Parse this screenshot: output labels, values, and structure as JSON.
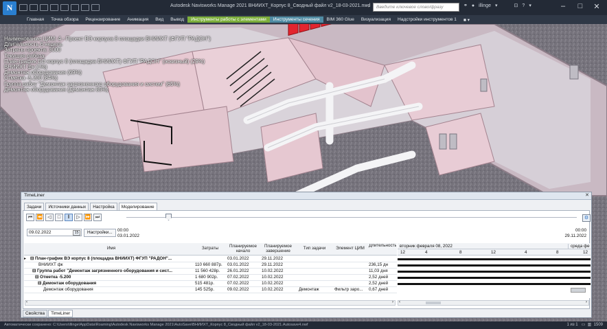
{
  "window": {
    "title": "Autodesk Navisworks Manage 2021   ВНИИХТ_Корпус 8_Сводный файл v2_18-03-2021.nwd",
    "search_placeholder": "Введите ключевое слово/фразу",
    "user": "illinge"
  },
  "ribbon_tabs": [
    "Главная",
    "Точка обзора",
    "Рецензирование",
    "Анимация",
    "Вид",
    "Вывод",
    "Инструменты работы с элементами",
    "Инструменты сечения",
    "BIM 360 Glue",
    "Визуализация",
    "Надстройки инструментов 1"
  ],
  "overlay": [
    "Наименование ЦИМ: 4 - Проект ВЭ корпуса 8 площадки ВНИИХТ (ФГУП \"РАДОН\")",
    "Длительность 6 недель",
    "Затраты проекта: 3000",
    "Текущая работа:",
    "План-график ВЭ корпус 8 (площадка ВНИИХТ) ФГУП \"РАДОН\" (эскизный) (29%)",
    "ВНИИХТ фк (1%)",
    "Демонтаж оборудования (69%)",
    "Отметка -5.200 (84%)",
    "Группа работ \"Демонтаж загрязненного оборудования и систем\" (65%)",
    "Демонтаж оборудования (Демонтаж 85%)"
  ],
  "timeliner": {
    "title": "TimeLiner",
    "tabs": [
      "Задачи",
      "Источники данных",
      "Настройка",
      "Моделирование"
    ],
    "current_date": "09.02.2022",
    "settings_button": "Настройки...",
    "start_time": "00:00",
    "start_date": "03.01.2022",
    "end_time": "00:00",
    "end_date": "29.11.2022",
    "columns": [
      "Имя",
      "Затраты",
      "Планируемое начало",
      "Планируемое завершение",
      "Тип задачи",
      "Элемент ЦИМ",
      "Длительность"
    ],
    "rows": [
      {
        "name": "⊟ План-график ВЭ корпус 8 (площадка ВНИИХТ) ФГУП \"РАДОН\"...",
        "cost": "",
        "start": "03.01.2022",
        "end": "29.11.2022",
        "type": "",
        "element": "",
        "duration": "",
        "bold": true
      },
      {
        "name": "ВНИИХТ фк",
        "cost": "110 660 887р.",
        "start": "03.01.2022",
        "end": "29.11.2022",
        "type": "",
        "element": "",
        "duration": "236,15 дн",
        "bold": false
      },
      {
        "name": "⊟ Группа работ \"Демонтаж загрязненного оборудования и сист...",
        "cost": "11 560 428р.",
        "start": "26.01.2022",
        "end": "10.02.2022",
        "type": "",
        "element": "",
        "duration": "11,03 дня",
        "bold": true
      },
      {
        "name": "⊟ Отметка -5.200",
        "cost": "1 680 902р.",
        "start": "07.02.2022",
        "end": "10.02.2022",
        "type": "",
        "element": "",
        "duration": "2,52 дней",
        "bold": true
      },
      {
        "name": "⊟ Демонтаж оборудования",
        "cost": "515 481р.",
        "start": "07.02.2022",
        "end": "10.02.2022",
        "type": "",
        "element": "",
        "duration": "2,52 дней",
        "bold": true
      },
      {
        "name": "Демонтаж оборудования",
        "cost": "145 525р.",
        "start": "09.02.2022",
        "end": "10.02.2022",
        "type": "Демонтаж",
        "element": "Фильтр заро...",
        "duration": "0,67 дней",
        "bold": false
      }
    ],
    "gantt_header_1": "вторник февраля 08, 2022",
    "gantt_header_1b": "среда фе",
    "gantt_hours": [
      "12",
      "4",
      "8",
      "12",
      "4",
      "8",
      "12"
    ],
    "bottom_tabs": [
      "Свойства",
      "TimeLiner"
    ]
  },
  "statusbar": {
    "text": "Автоматически сохранено: C:\\Users\\illinge\\AppData\\Roaming\\Autodesk Navisworks Manage 2021\\AutoSave\\ВНИИХТ_Корпус 8_Сводный файл v2_18-03-2021.Autosave4.nwf",
    "page": "1 из 1",
    "memory": "1509"
  }
}
